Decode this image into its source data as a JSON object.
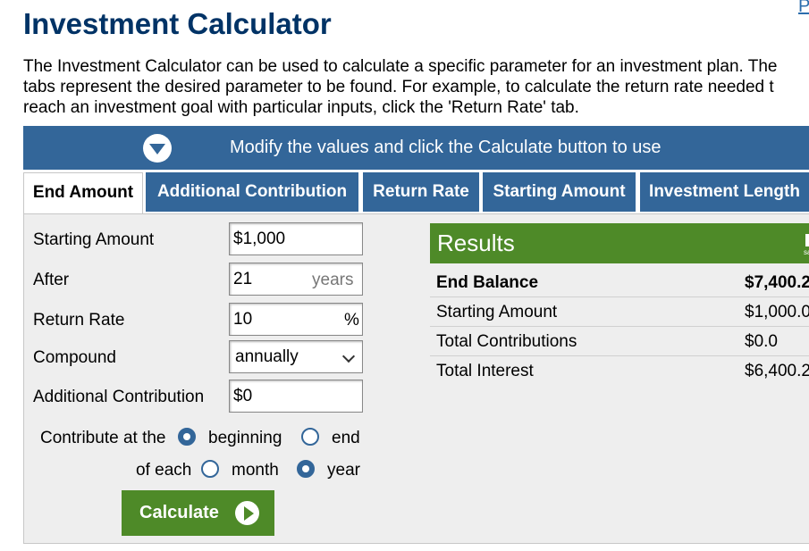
{
  "top_link": "P",
  "title": "Investment Calculator",
  "intro": [
    "The Investment Calculator can be used to calculate a specific parameter for an investment plan. The",
    "tabs represent the desired parameter to be found. For example, to calculate the return rate needed t",
    "reach an investment goal with particular inputs, click the 'Return Rate' tab."
  ],
  "banner": {
    "text": "Modify the values and click the Calculate button to use"
  },
  "tabs": [
    {
      "label": "End Amount",
      "active": true
    },
    {
      "label": "Additional Contribution"
    },
    {
      "label": "Return Rate"
    },
    {
      "label": "Starting Amount"
    },
    {
      "label": "Investment Length"
    }
  ],
  "form": {
    "starting_amount": {
      "label": "Starting Amount",
      "value": "$1,000"
    },
    "after": {
      "label": "After",
      "value": "21",
      "suffix": "years"
    },
    "return_rate": {
      "label": "Return Rate",
      "value": "10",
      "suffix": "%"
    },
    "compound": {
      "label": "Compound",
      "value": "annually"
    },
    "additional_contribution": {
      "label": "Additional Contribution",
      "value": "$0"
    },
    "contribute_at": {
      "label": "Contribute at the",
      "opt_beginning": "beginning",
      "opt_end": "end",
      "selected": "beginning"
    },
    "of_each": {
      "label": "of each",
      "opt_month": "month",
      "opt_year": "year",
      "selected": "year"
    },
    "calculate_label": "Calculate"
  },
  "results": {
    "title": "Results",
    "save_label": "sa",
    "rows": [
      {
        "label": "End Balance",
        "value": "$7,400.2"
      },
      {
        "label": "Starting Amount",
        "value": "$1,000.0"
      },
      {
        "label": "Total Contributions",
        "value": "$0.0"
      },
      {
        "label": "Total Interest",
        "value": "$6,400.2"
      }
    ]
  },
  "colors": {
    "brand_blue": "#336699",
    "title_navy": "#003366",
    "accent_green": "#4e8a28"
  }
}
